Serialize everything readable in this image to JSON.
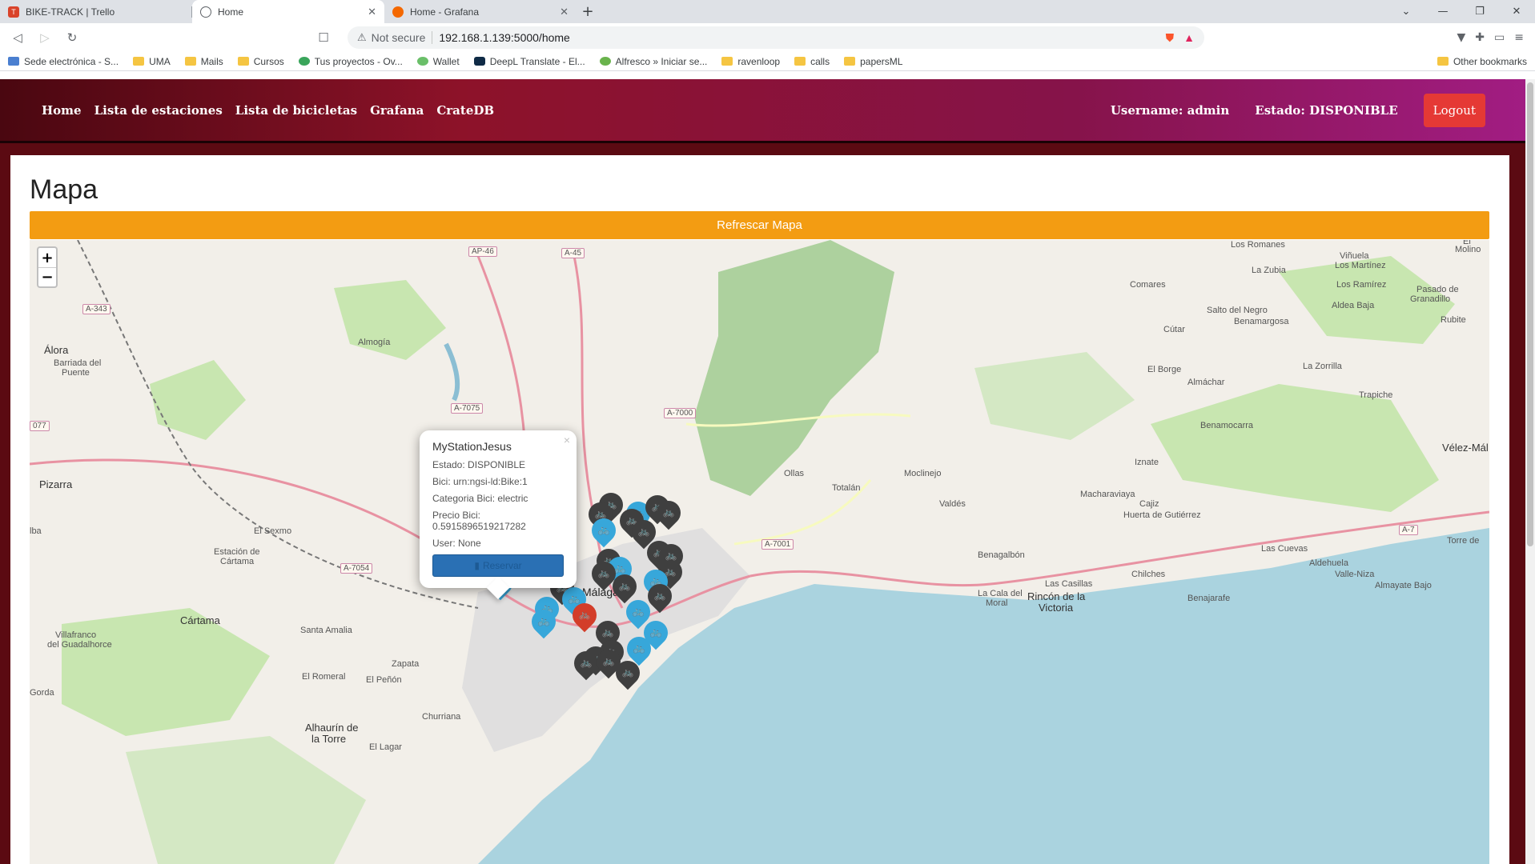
{
  "browser": {
    "tabs": [
      {
        "title": "BIKE-TRACK | Trello",
        "favicon": "trello-icon",
        "color": "#d9432a"
      },
      {
        "title": "Home",
        "favicon": "globe-icon",
        "color": "#5f6368"
      },
      {
        "title": "Home - Grafana",
        "favicon": "grafana-icon",
        "color": "#f46800"
      }
    ],
    "address": {
      "security": "Not secure",
      "url": "192.168.1.139:5000/home"
    },
    "bookmarks": [
      {
        "label": "Sede electrónica - S...",
        "icon": "site-icon"
      },
      {
        "label": "UMA",
        "icon": "folder-icon"
      },
      {
        "label": "Mails",
        "icon": "folder-icon"
      },
      {
        "label": "Cursos",
        "icon": "folder-icon"
      },
      {
        "label": "Tus proyectos - Ov...",
        "icon": "site-icon"
      },
      {
        "label": "Wallet",
        "icon": "site-icon"
      },
      {
        "label": "DeepL Translate - El...",
        "icon": "site-icon"
      },
      {
        "label": "Alfresco » Iniciar se...",
        "icon": "site-icon"
      },
      {
        "label": "ravenloop",
        "icon": "folder-icon"
      },
      {
        "label": "calls",
        "icon": "folder-icon"
      },
      {
        "label": "papersML",
        "icon": "folder-icon"
      }
    ],
    "other_bookmarks": "Other bookmarks"
  },
  "nav": {
    "links": [
      "Home",
      "Lista de estaciones",
      "Lista de bicicletas",
      "Grafana",
      "CrateDB"
    ],
    "username": "Username: admin",
    "estado": "Estado: DISPONIBLE",
    "logout": "Logout"
  },
  "page": {
    "title": "Mapa",
    "refresh": "Refrescar Mapa"
  },
  "map": {
    "zoom_in": "+",
    "zoom_out": "−",
    "labels": {
      "alora": "Álora",
      "barrida": "Barriada del",
      "puente": "Puente",
      "almogia": "Almogía",
      "pizarra": "Pizarra",
      "sexmo": "El Sexmo",
      "estacion": "Estación de",
      "cartama_st": "Cártama",
      "cartama": "Cártama",
      "villafranco": "Villafranco",
      "guadalhorce": "del Guadalhorce",
      "santa_amalia": "Santa Amalia",
      "zapata": "Zapata",
      "romeral": "El Romeral",
      "penon": "El Peñón",
      "alhaurin": "Alhaurín de",
      "la_torre": "la Torre",
      "churriana": "Churriana",
      "lagar": "El Lagar",
      "malaga": "Málaga",
      "ollas": "Ollas",
      "totalan": "Totalán",
      "moclinejo": "Moclinejo",
      "valdes": "Valdés",
      "benagalbon": "Benagalbón",
      "cala_moral": "La Cala del",
      "moral": "Moral",
      "rincon": "Rincón de la",
      "victoria": "Victoria",
      "cajiz": "Cajiz",
      "macharaviaya": "Macharaviaya",
      "huerta": "Huerta de Gutiérrez",
      "iznate": "Iznate",
      "benamocarra": "Benamocarra",
      "velez": "Vélez-Mál",
      "chilches": "Chilches",
      "benajarafe": "Benajarafe",
      "valle_niza": "Valle-Niza",
      "almayate": "Almayate Bajo",
      "las_cuevas": "Las Cuevas",
      "aldehuela": "Aldehuela",
      "torre": "Torre de",
      "comares": "Comares",
      "salto": "Salto del Negro",
      "benamargosa": "Benamargosa",
      "cutar": "Cútar",
      "el_borge": "El Borge",
      "almachar": "Almáchar",
      "la_zorrilla": "La Zorrilla",
      "trapiche": "Trapiche",
      "la_zubia": "La Zubia",
      "vinuela": "Viñuela",
      "los_martinez": "Los Martínez",
      "los_ramirez": "Los Ramírez",
      "aldea_baja": "Aldea Baja",
      "pasado": "Pasado de",
      "granadillo": "Granadillo",
      "rubite": "Rubite",
      "los_romanes": "Los Romanes",
      "el_molino": "El",
      "molino": "Molino",
      "casillas": "Las Casillas",
      "gorda": "Gorda",
      "lba": "lba"
    },
    "roads": [
      "A-343",
      "AP-46",
      "A-45",
      "A-7075",
      "A-7000",
      "A-7054",
      "A-7001",
      "A-7",
      "077"
    ],
    "popup": {
      "title": "MyStationJesus",
      "estado": "Estado: DISPONIBLE",
      "bici": "Bici: urn:ngsi-ld:Bike:1",
      "categoria": "Categoria Bici: electric",
      "precio": "Precio Bici: 0.5915896519217282",
      "user": "User: None",
      "button": "Reservar",
      "close": "×"
    }
  }
}
